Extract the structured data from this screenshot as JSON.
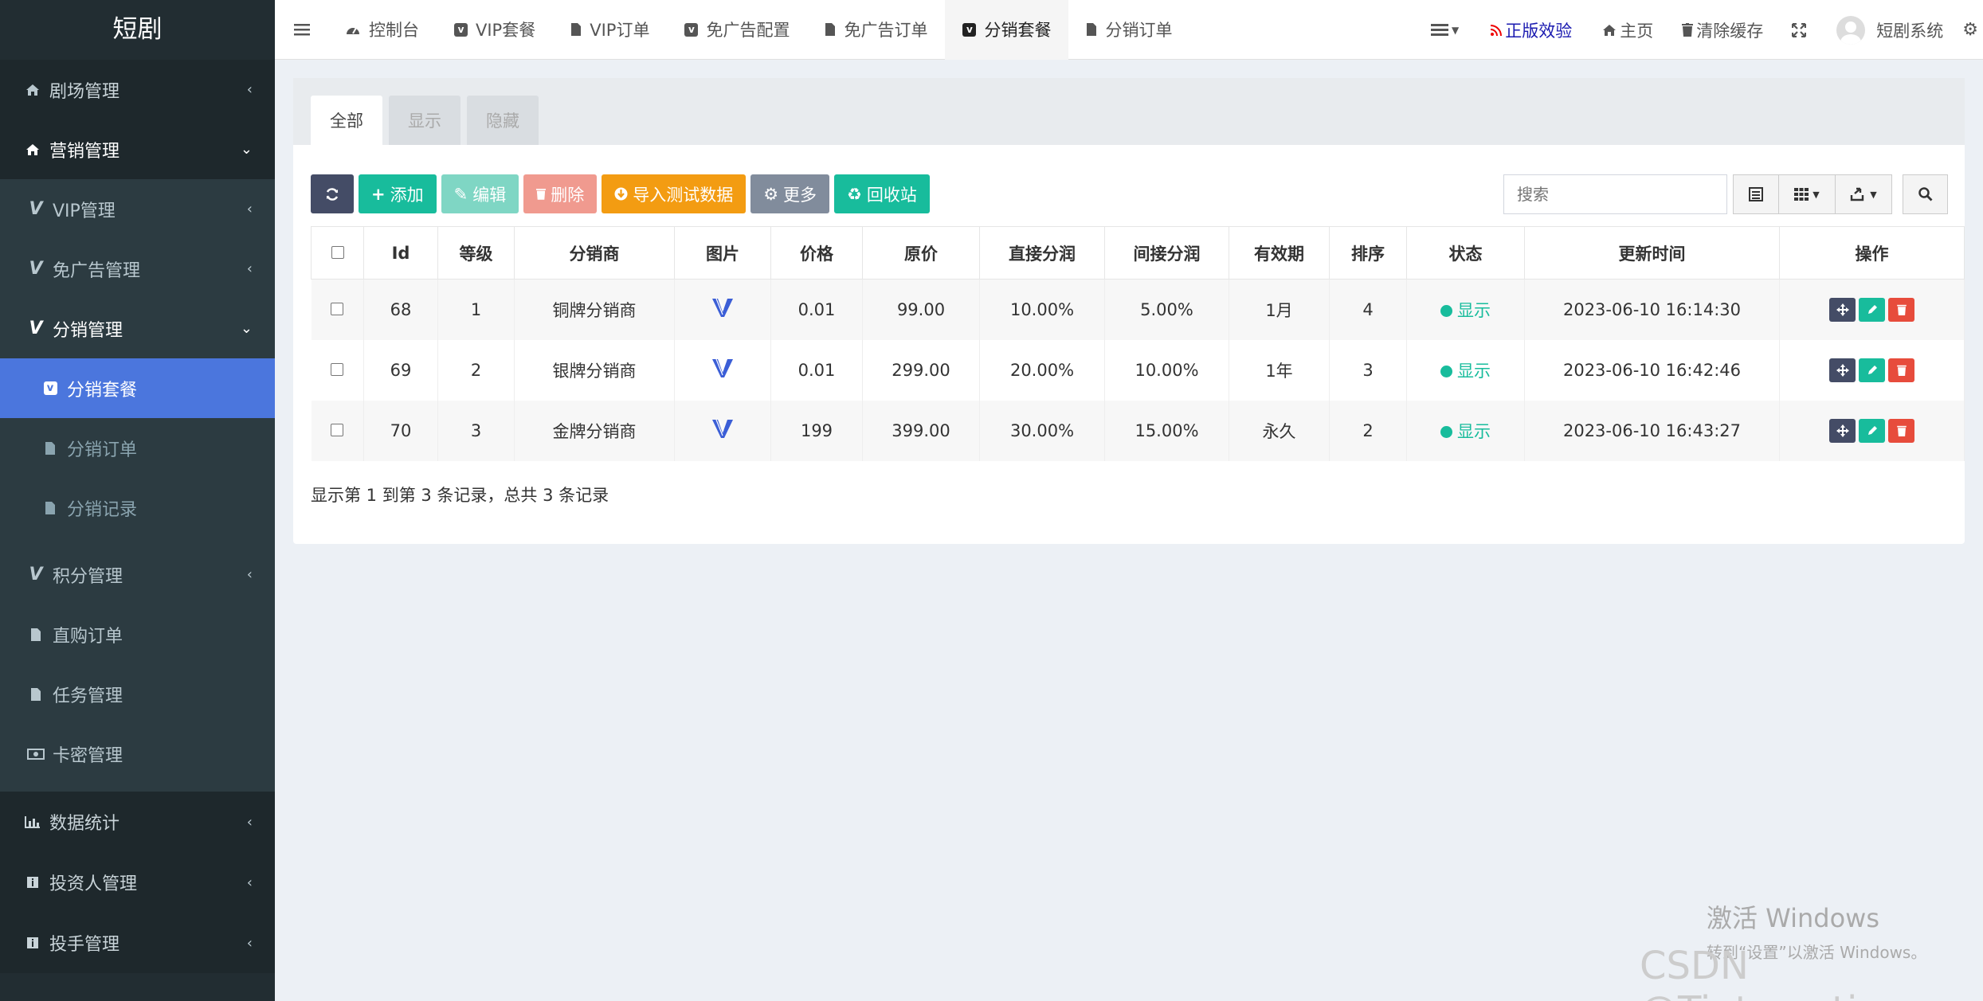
{
  "brand": "短剧",
  "sidebar": {
    "top": [
      {
        "label": "剧场管理",
        "icon": "home-icon"
      },
      {
        "label": "营销管理",
        "icon": "home-icon"
      }
    ],
    "sub": [
      {
        "label": "VIP管理",
        "icon": "vimeo-icon"
      },
      {
        "label": "免广告管理",
        "icon": "vimeo-icon"
      },
      {
        "label": "分销管理",
        "icon": "vimeo-icon"
      }
    ],
    "sub2": [
      {
        "label": "分销套餐",
        "icon": "vimeo-icon"
      },
      {
        "label": "分销订单",
        "icon": "file-icon"
      },
      {
        "label": "分销记录",
        "icon": "file-icon"
      }
    ],
    "mid": [
      {
        "label": "积分管理",
        "icon": "vimeo-icon"
      },
      {
        "label": "直购订单",
        "icon": "file-icon"
      },
      {
        "label": "任务管理",
        "icon": "file-icon"
      },
      {
        "label": "卡密管理",
        "icon": "money-icon"
      }
    ],
    "bottom": [
      {
        "label": "数据统计",
        "icon": "bar-chart-icon"
      },
      {
        "label": "投资人管理",
        "icon": "info-icon"
      },
      {
        "label": "投手管理",
        "icon": "info-icon"
      }
    ]
  },
  "topnav": {
    "tabs": [
      {
        "label": "控制台",
        "icon": "dashboard-icon"
      },
      {
        "label": "VIP套餐",
        "icon": "vimeo-icon"
      },
      {
        "label": "VIP订单",
        "icon": "file-icon"
      },
      {
        "label": "免广告配置",
        "icon": "vimeo-icon"
      },
      {
        "label": "免广告订单",
        "icon": "file-icon"
      },
      {
        "label": "分销套餐",
        "icon": "vimeo-icon"
      },
      {
        "label": "分销订单",
        "icon": "file-icon"
      }
    ],
    "genuine": "正版效验",
    "home": "主页",
    "clear_cache": "清除缓存",
    "user": "短剧系统"
  },
  "page_tabs": [
    "全部",
    "显示",
    "隐藏"
  ],
  "toolbar": {
    "add": "添加",
    "edit": "编辑",
    "delete": "删除",
    "import": "导入测试数据",
    "more": "更多",
    "recycle": "回收站"
  },
  "search": {
    "placeholder": "搜索"
  },
  "table": {
    "headers": [
      "Id",
      "等级",
      "分销商",
      "图片",
      "价格",
      "原价",
      "直接分润",
      "间接分润",
      "有效期",
      "排序",
      "状态",
      "更新时间",
      "操作"
    ],
    "rows": [
      [
        "68",
        "1",
        "铜牌分销商",
        "0.01",
        "99.00",
        "10.00%",
        "5.00%",
        "1月",
        "4",
        "显示",
        "2023-06-10 16:14:30"
      ],
      [
        "69",
        "2",
        "银牌分销商",
        "0.01",
        "299.00",
        "20.00%",
        "10.00%",
        "1年",
        "3",
        "显示",
        "2023-06-10 16:42:46"
      ],
      [
        "70",
        "3",
        "金牌分销商",
        "199",
        "399.00",
        "30.00%",
        "15.00%",
        "永久",
        "2",
        "显示",
        "2023-06-10 16:43:27"
      ]
    ]
  },
  "pagination_info": "显示第 1 到第 3 条记录，总共 3 条记录",
  "watermark": {
    "line1": "激活 Windows",
    "line2": "转到“设置”以激活 Windows。",
    "csdn": "CSDN @Tinteresting"
  },
  "colors": {
    "sidebar": "#222d32",
    "active": "#4b76dd",
    "success": "#18bc9c",
    "danger": "#e74c3c",
    "warning": "#f39c12"
  }
}
